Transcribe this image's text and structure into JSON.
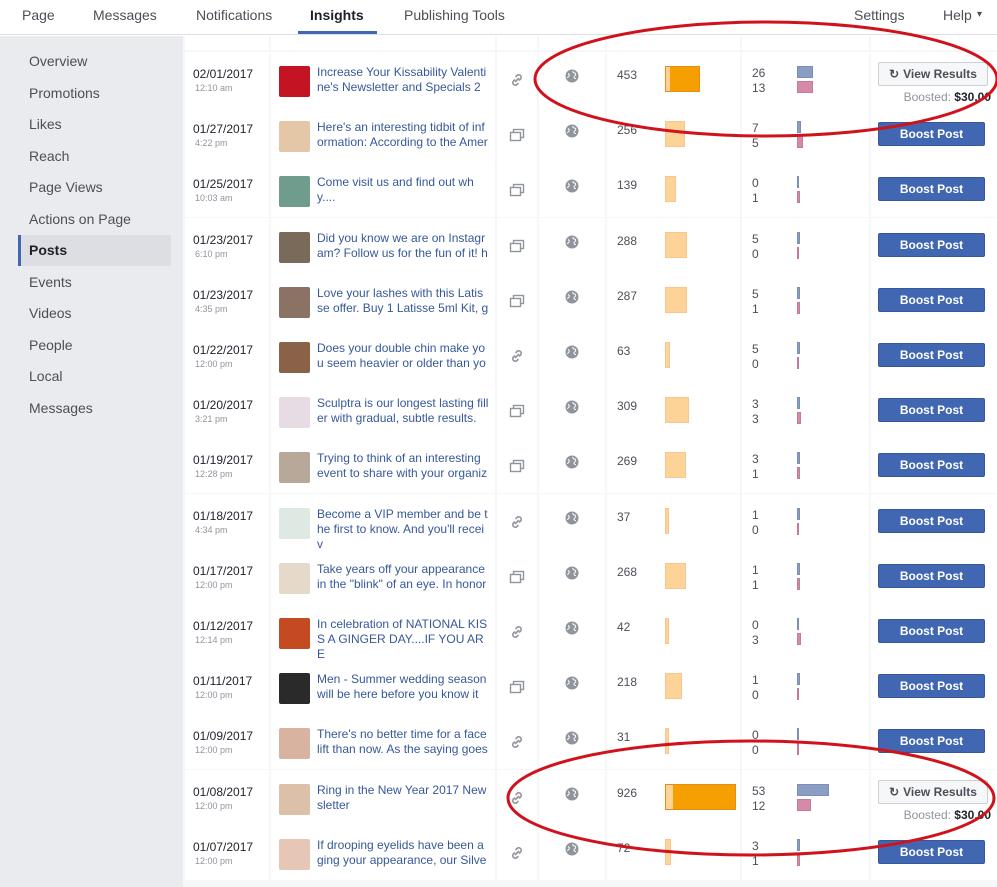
{
  "nav": {
    "tabs": [
      "Page",
      "Messages",
      "Notifications",
      "Insights",
      "Publishing Tools"
    ],
    "settings": "Settings",
    "help": "Help",
    "help_caret": "▾"
  },
  "sidebar": {
    "items": [
      "Overview",
      "Promotions",
      "Likes",
      "Reach",
      "Page Views",
      "Actions on Page",
      "Posts",
      "Events",
      "Videos",
      "People",
      "Local",
      "Messages"
    ],
    "active": "Posts"
  },
  "colors": {
    "accent": "#4267b2",
    "reach_paid": "#f5a000",
    "reach_organic": "#fdd397",
    "clicks": "#8b9dc3",
    "reactions": "#d48aa8",
    "annotation": "#d0121c"
  },
  "labels": {
    "boost": "Boost Post",
    "view_results": "View Results",
    "boosted": "Boosted:",
    "refresh_icon": "↻"
  },
  "posts": [
    {
      "date": "02/01/2017",
      "time": "12:10 am",
      "text": "Increase Your Kissability Valentine's Newsletter and Specials 2",
      "type": "link-icon",
      "reach": 453,
      "clicks": 26,
      "reactions": 13,
      "boosted": "$30.00",
      "thumb": "#c41424"
    },
    {
      "date": "01/27/2017",
      "time": "4:22 pm",
      "text": "Here's an interesting tidbit of information: According to the Amer",
      "type": "photo-icon",
      "reach": 256,
      "clicks": 7,
      "reactions": 5,
      "thumb": "#e3c7a6"
    },
    {
      "date": "01/25/2017",
      "time": "10:03 am",
      "text": "Come visit us and find out why....",
      "type": "photo-icon",
      "reach": 139,
      "clicks": 0,
      "reactions": 1,
      "thumb": "#6f9c8c"
    },
    {
      "date": "01/23/2017",
      "time": "6:10 pm",
      "text": "Did you know we are on Instagram? Follow us for the fun of it! h",
      "type": "photo-icon",
      "reach": 288,
      "clicks": 5,
      "reactions": 0,
      "thumb": "#7a6a5a"
    },
    {
      "date": "01/23/2017",
      "time": "4:35 pm",
      "text": "Love your lashes with this Latisse offer. Buy 1 Latisse 5ml Kit, g",
      "type": "photo-icon",
      "reach": 287,
      "clicks": 5,
      "reactions": 1,
      "thumb": "#8a7264"
    },
    {
      "date": "01/22/2017",
      "time": "12:00 pm",
      "text": "Does your double chin make you seem heavier or older than yo",
      "type": "link-icon",
      "reach": 63,
      "clicks": 5,
      "reactions": 0,
      "thumb": "#8a6248"
    },
    {
      "date": "01/20/2017",
      "time": "3:21 pm",
      "text": "Sculptra is our longest lasting filler with gradual, subtle results.",
      "type": "photo-icon",
      "reach": 309,
      "clicks": 3,
      "reactions": 3,
      "thumb": "#e8dce4"
    },
    {
      "date": "01/19/2017",
      "time": "12:28 pm",
      "text": "Trying to think of an interesting event to share with your organiz",
      "type": "photo-icon",
      "reach": 269,
      "clicks": 3,
      "reactions": 1,
      "thumb": "#b8a89a"
    },
    {
      "date": "01/18/2017",
      "time": "4:34 pm",
      "text": "Become a VIP member and be the first to know. And you'll receiv",
      "type": "link-icon",
      "reach": 37,
      "clicks": 1,
      "reactions": 0,
      "thumb": "#dfe9e3"
    },
    {
      "date": "01/17/2017",
      "time": "12:00 pm",
      "text": "Take years off your appearance in the \"blink\" of an eye. In honor",
      "type": "photo-icon",
      "reach": 268,
      "clicks": 1,
      "reactions": 1,
      "thumb": "#e5d9ca"
    },
    {
      "date": "01/12/2017",
      "time": "12:14 pm",
      "text": "In celebration of NATIONAL KISS A GINGER DAY....IF YOU ARE",
      "type": "link-icon",
      "reach": 42,
      "clicks": 0,
      "reactions": 3,
      "thumb": "#c44a22"
    },
    {
      "date": "01/11/2017",
      "time": "12:00 pm",
      "text": "Men - Summer wedding season will be here before you know it",
      "type": "photo-icon",
      "reach": 218,
      "clicks": 1,
      "reactions": 0,
      "thumb": "#2a2a2a"
    },
    {
      "date": "01/09/2017",
      "time": "12:00 pm",
      "text": "There's no better time for a facelift than now. As the saying goes",
      "type": "link-icon",
      "reach": 31,
      "clicks": 0,
      "reactions": 0,
      "thumb": "#d8b3a0"
    },
    {
      "date": "01/08/2017",
      "time": "12:00 pm",
      "text": "Ring in the New Year 2017 Newsletter",
      "type": "link-icon",
      "reach": 926,
      "clicks": 53,
      "reactions": 12,
      "boosted": "$30.00",
      "thumb": "#dcc0a8"
    },
    {
      "date": "01/07/2017",
      "time": "12:00 pm",
      "text": "If drooping eyelids have been aging your appearance, our Silve",
      "type": "link-icon",
      "reach": 72,
      "clicks": 3,
      "reactions": 1,
      "thumb": "#e6c7b5"
    }
  ]
}
